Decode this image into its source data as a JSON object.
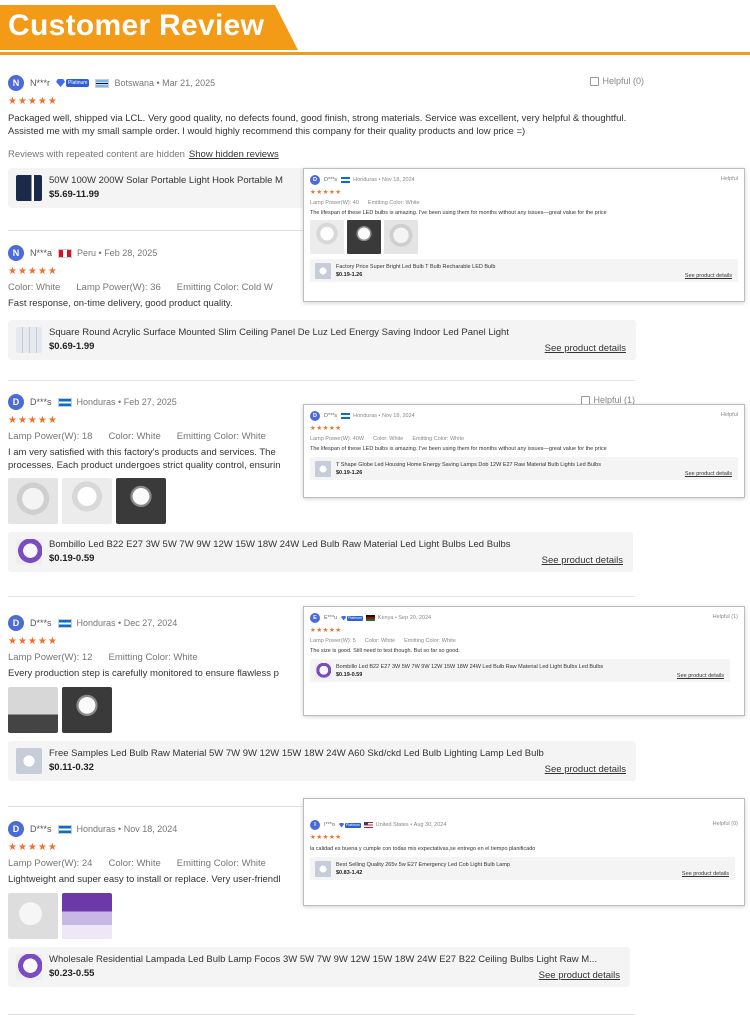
{
  "header": {
    "title": "Customer Review"
  },
  "reviews": [
    {
      "initial": "N",
      "name": "N***r",
      "badge": "Platinum",
      "country": "Botswana",
      "date": "Mar 21, 2025",
      "helpful": "Helpful (0)",
      "stars": "★★★★★",
      "text": "Packaged well, shipped via LCL. Very good quality, no defects found, good finish, strong materials. Service  was excellent, very helpful & thoughtful. Assisted me with my small sample order. I would highly recommend this company for their quality products and low price =)",
      "hidden_note": "Reviews with repeated content are hidden",
      "hidden_link": "Show hidden reviews",
      "product": {
        "title": "50W 100W 200W Solar Portable Light Hook Portable M",
        "price": "$5.69-11.99"
      }
    },
    {
      "initial": "N",
      "name": "N***a",
      "country": "Peru",
      "date": "Feb 28, 2025",
      "stars": "★★★★★",
      "attrs": [
        "Color:  White",
        "Lamp Power(W):  36",
        "Emitting Color:  Cold W"
      ],
      "text": "Fast response, on-time delivery, good product quality.",
      "product": {
        "title": "Square Round Acrylic Surface Mounted Slim Ceiling Panel De Luz Led Energy Saving Indoor Led Panel Light",
        "price": "$0.69-1.99",
        "link": "See product details"
      }
    },
    {
      "initial": "D",
      "name": "D***s",
      "country": "Honduras",
      "date": "Feb 27, 2025",
      "helpful": "Helpful (1)",
      "stars": "★★★★★",
      "attrs": [
        "Lamp Power(W):  18",
        "Color:  White",
        "Emitting Color:  White"
      ],
      "text": "I am very satisfied with this factory's products and services. The processes. Each product undergoes strict quality control, ensurin",
      "product": {
        "title": "Bombillo Led B22 E27 3W 5W 7W 9W 12W 15W 18W 24W Led Bulb Raw Material Led Light Bulbs Led Bulbs",
        "price": "$0.19-0.59",
        "link": "See product details"
      }
    },
    {
      "initial": "D",
      "name": "D***s",
      "country": "Honduras",
      "date": "Dec 27, 2024",
      "stars": "★★★★★",
      "attrs": [
        "Lamp Power(W):  12",
        "Emitting Color:  White"
      ],
      "text": "Every production step is carefully monitored to ensure flawless p",
      "product": {
        "title": "Free Samples Led Bulb Raw Material 5W 7W 9W 12W 15W 18W 24W A60 Skd/ckd Led Bulb Lighting Lamp Led Bulb",
        "price": "$0.11-0.32",
        "link": "See product details"
      }
    },
    {
      "initial": "D",
      "name": "D***s",
      "country": "Honduras",
      "date": "Nov 18, 2024",
      "stars": "★★★★★",
      "attrs": [
        "Lamp Power(W):  24",
        "Color:  White",
        "Emitting Color:  White"
      ],
      "text": "Lightweight and super easy to install or replace. Very user-friendl",
      "product": {
        "title": "Wholesale Residential Lampada Led Bulb Lamp Focos 3W 5W 7W 9W 12W 15W 18W 24W E27 B22 Ceiling Bulbs Light Raw M...",
        "price": "$0.23-0.55",
        "link": "See product details"
      }
    }
  ],
  "popups": [
    {
      "initial": "D",
      "name": "D***s",
      "country": "Honduras",
      "date": "Nov 18, 2024",
      "helpful": "Helpful",
      "stars": "★★★★★",
      "attrs": [
        "Lamp Power(W):  40",
        "Emitting Color:  White"
      ],
      "text": "The lifespan of these LED bulbs is amazing. I've been using them for months without any issues—great value for the price",
      "product": {
        "title": "Factory Price Super Bright Led Bulb T Bulb Recharable LED Bulb",
        "price": "$0.19-1.26",
        "link": "See product details"
      }
    },
    {
      "initial": "D",
      "name": "D***s",
      "country": "Honduras",
      "date": "Nov 18, 2024",
      "helpful": "Helpful",
      "stars": "★★★★★",
      "attrs": [
        "Lamp Power(W):  40W",
        "Color:  White",
        "Emitting Color:  White"
      ],
      "text": "The lifespan of these LED bulbs is amazing. I've been using them for months without any issues—great value for the price",
      "product": {
        "title": "T Shape Globe Led Housing Home Energy Saving Lamps Dob 12W E27 Raw Material Bulb Lights Led Bulbs",
        "price": "$0.19-1.26",
        "link": "See product details"
      }
    },
    {
      "initial": "E",
      "name": "E***u",
      "badge": "Platinum",
      "country": "Kenya",
      "date": "Sep 20, 2024",
      "helpful": "Helpful (1)",
      "stars": "★★★★★",
      "attrs": [
        "Lamp Power(W):  5",
        "Color:  White",
        "Emitting Color:  White"
      ],
      "text": "The size is good. Still need to test though. But so far so good.",
      "product": {
        "title": "Bombillo Led B22 E27 3W 5W 7W 9W 12W 15W 18W 24W Led Bulb Raw Material Led Light Bulbs Led Bulbs",
        "price": "$0.19-0.59",
        "link": "See product details"
      }
    },
    {
      "initial": "I",
      "name": "I***o",
      "badge": "Platinum",
      "country": "United States",
      "date": "Aug 30, 2024",
      "helpful": "Helpful (0)",
      "stars": "★★★★★",
      "text": "la calidad es buena y cumple con todas mis expectativas,se entrego en el tiempo planificado",
      "product": {
        "title": "Best Selling Quality 265v 5w E27 Emergency Led Cob Light Bulb Lamp",
        "price": "$0.83-1.42",
        "link": "See product details"
      }
    }
  ]
}
